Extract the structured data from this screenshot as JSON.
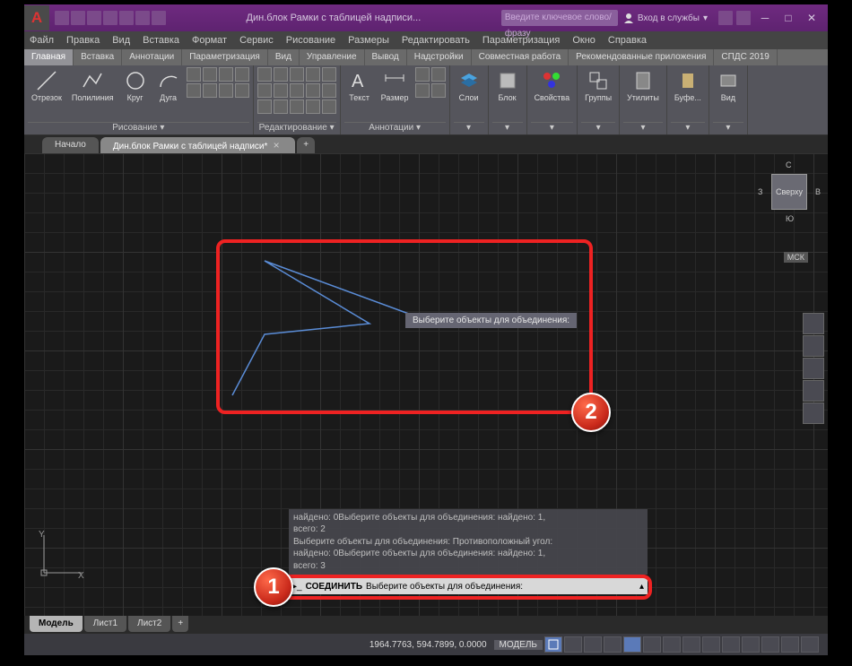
{
  "title": "Дин.блок Рамки с таблицей надписи...",
  "search_placeholder": "Введите ключевое слово/фразу",
  "signin": "Вход в службы",
  "menu": [
    "Файл",
    "Правка",
    "Вид",
    "Вставка",
    "Формат",
    "Сервис",
    "Рисование",
    "Размеры",
    "Редактировать",
    "Параметризация",
    "Окно",
    "Справка"
  ],
  "ribbon_tabs": [
    "Главная",
    "Вставка",
    "Аннотации",
    "Параметризация",
    "Вид",
    "Управление",
    "Вывод",
    "Надстройки",
    "Совместная работа",
    "Рекомендованные приложения",
    "СПДС 2019"
  ],
  "ribbon_active": 0,
  "panels": {
    "draw": {
      "label": "Рисование ▾",
      "b": [
        "Отрезок",
        "Полилиния",
        "Круг",
        "Дуга"
      ]
    },
    "edit": {
      "label": "Редактирование ▾"
    },
    "ann": {
      "label": "Аннотации ▾",
      "text": "Текст",
      "dim": "Размер"
    },
    "layers": "Слои",
    "block": "Блок",
    "props": "Свойства",
    "groups": "Группы",
    "util": "Утилиты",
    "clip": "Буфе...",
    "view": "Вид"
  },
  "doc_tabs": [
    "Начало",
    "Дин.блок Рамки с таблицей надписи*"
  ],
  "doc_active": 1,
  "viewcube": {
    "face": "Сверху",
    "n": "С",
    "s": "Ю",
    "e": "В",
    "w": "З",
    "cs": "МСК"
  },
  "tooltip": "Выберите объекты для объединения:",
  "history": [
    "найдено: 0Выберите объекты для объединения: найдено: 1,",
    "всего: 2",
    "",
    "Выберите объекты для объединения: Противоположный угол:",
    "найдено: 0Выберите объекты для объединения: найдено: 1,",
    "всего: 3"
  ],
  "cmd": {
    "name": "СОЕДИНИТЬ",
    "prompt": "Выберите объекты для объединения:"
  },
  "model_tabs": [
    "Модель",
    "Лист1",
    "Лист2"
  ],
  "model_active": 0,
  "status": {
    "coords": "1964.7763, 594.7899, 0.0000",
    "space": "МОДЕЛЬ"
  }
}
